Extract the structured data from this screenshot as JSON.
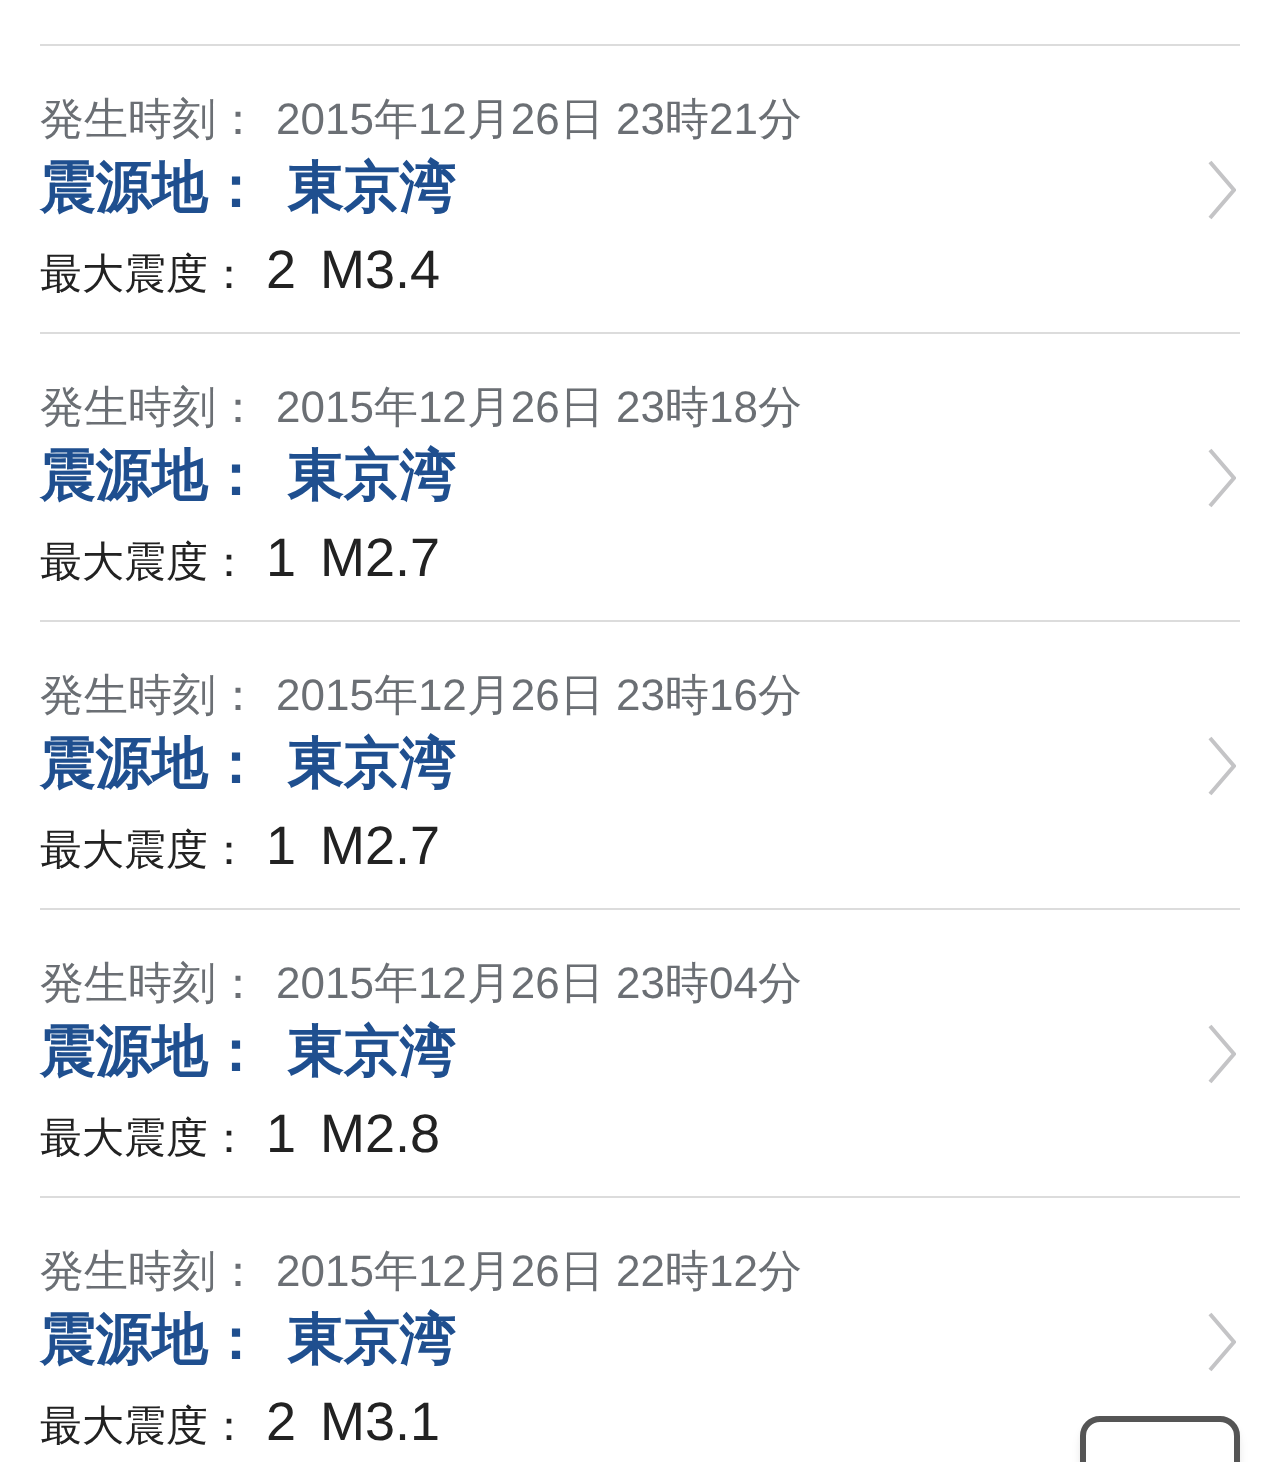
{
  "quakes": [
    {
      "time_label": "発生時刻：",
      "time": "2015年12月26日 23時21分",
      "epicenter_label": "震源地：",
      "epicenter": "東京湾",
      "intensity_label": "最大震度：",
      "intensity": "2",
      "magnitude": "M3.4"
    },
    {
      "time_label": "発生時刻：",
      "time": "2015年12月26日 23時18分",
      "epicenter_label": "震源地：",
      "epicenter": "東京湾",
      "intensity_label": "最大震度：",
      "intensity": "1",
      "magnitude": "M2.7"
    },
    {
      "time_label": "発生時刻：",
      "time": "2015年12月26日 23時16分",
      "epicenter_label": "震源地：",
      "epicenter": "東京湾",
      "intensity_label": "最大震度：",
      "intensity": "1",
      "magnitude": "M2.7"
    },
    {
      "time_label": "発生時刻：",
      "time": "2015年12月26日 23時04分",
      "epicenter_label": "震源地：",
      "epicenter": "東京湾",
      "intensity_label": "最大震度：",
      "intensity": "1",
      "magnitude": "M2.8"
    },
    {
      "time_label": "発生時刻：",
      "time": "2015年12月26日 22時12分",
      "epicenter_label": "震源地：",
      "epicenter": "東京湾",
      "intensity_label": "最大震度：",
      "intensity": "2",
      "magnitude": "M3.1"
    }
  ]
}
